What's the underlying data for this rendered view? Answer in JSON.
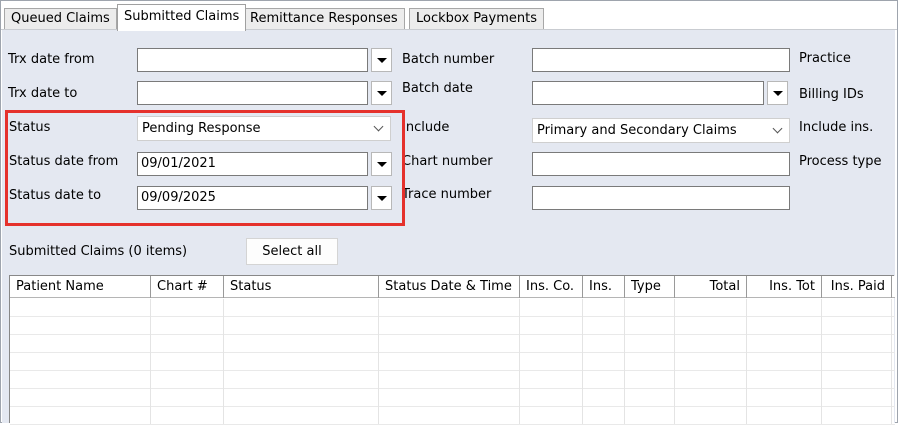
{
  "tabs": [
    {
      "label": "Queued Claims"
    },
    {
      "label": "Submitted Claims"
    },
    {
      "label": "Remittance Responses"
    },
    {
      "label": "Lockbox Payments"
    }
  ],
  "filters": {
    "trx_date_from": {
      "label": "Trx date from",
      "value": ""
    },
    "trx_date_to": {
      "label": "Trx date to",
      "value": ""
    },
    "status": {
      "label": "Status",
      "value": "Pending Response"
    },
    "status_date_from": {
      "label": "Status date from",
      "value": "09/01/2021"
    },
    "status_date_to": {
      "label": "Status date to",
      "value": "09/09/2025"
    },
    "batch_number": {
      "label": "Batch number",
      "value": ""
    },
    "batch_date": {
      "label": "Batch date",
      "value": ""
    },
    "include": {
      "label": "Include",
      "value": "Primary and Secondary Claims"
    },
    "chart_number": {
      "label": "Chart number",
      "value": ""
    },
    "trace_number": {
      "label": "Trace number",
      "value": ""
    },
    "practice": {
      "label": "Practice"
    },
    "billing_ids": {
      "label": "Billing IDs"
    },
    "include_ins": {
      "label": "Include ins."
    },
    "process_type": {
      "label": "Process type"
    }
  },
  "grid": {
    "title": "Submitted Claims (0 items)",
    "select_all_label": "Select all",
    "columns": [
      {
        "label": "Patient Name"
      },
      {
        "label": "Chart #"
      },
      {
        "label": "Status"
      },
      {
        "label": "Status Date & Time"
      },
      {
        "label": "Ins. Co."
      },
      {
        "label": "Ins."
      },
      {
        "label": "Type"
      },
      {
        "label": "Total"
      },
      {
        "label": "Ins. Tot"
      },
      {
        "label": "Ins. Paid"
      }
    ]
  },
  "colors": {
    "panel_bg": "#e4e8f1",
    "highlight": "#e5312c"
  }
}
